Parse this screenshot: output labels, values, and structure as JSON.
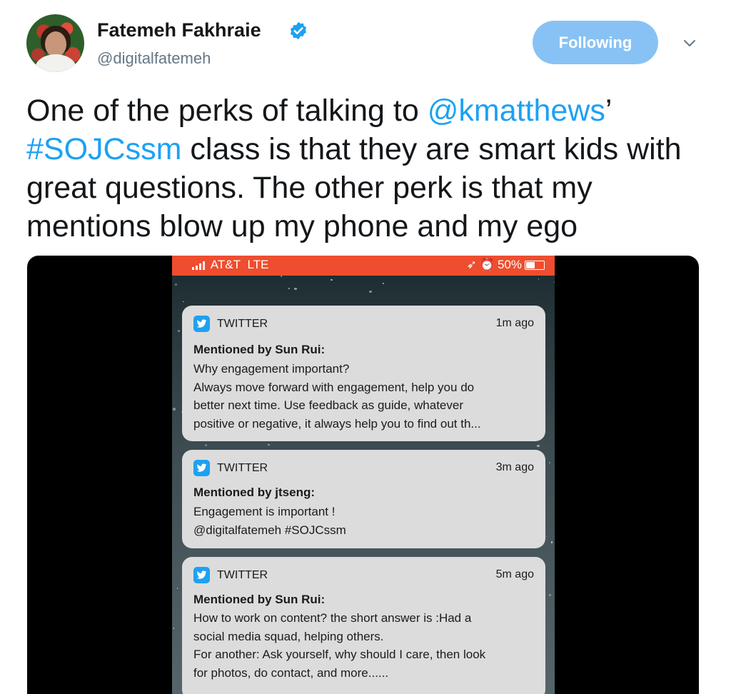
{
  "author": {
    "name": "Fatemeh Fakhraie",
    "handle": "@digitalfatemeh",
    "verified": true
  },
  "follow_button": {
    "label": "Following"
  },
  "menu_icon": "chevron-down-icon",
  "tweet": {
    "segments": [
      {
        "text": "One of the perks of talking to ",
        "type": "text"
      },
      {
        "text": "@kmatthews",
        "type": "mention"
      },
      {
        "text": "’ ",
        "type": "text"
      },
      {
        "text": "#SOJCssm",
        "type": "hashtag"
      },
      {
        "text": " class is that they are smart kids with great questions. The other perk is that my mentions blow up my phone and my ego",
        "type": "text"
      }
    ]
  },
  "phone": {
    "status": {
      "carrier": "AT&T",
      "network": "LTE",
      "battery": "50%"
    },
    "notifications": [
      {
        "app": "TWITTER",
        "time": "1m ago",
        "title": "Mentioned by Sun Rui:",
        "lines": [
          "Why engagement important?",
          "Always move forward with engagement, help you do",
          "better next time. Use feedback as guide, whatever",
          "positive or negative, it always help you to find out th..."
        ]
      },
      {
        "app": "TWITTER",
        "time": "3m ago",
        "title": "Mentioned by jtseng:",
        "lines": [
          "Engagement is important !",
          "@digitalfatemeh  #SOJCssm"
        ]
      },
      {
        "app": "TWITTER",
        "time": "5m ago",
        "title": "Mentioned by Sun Rui:",
        "lines": [
          "How to work on content? the short answer is :Had a",
          "social media squad, helping others.",
          "For another: Ask yourself, why should I care, then look",
          "for photos, do contact, and more......"
        ]
      }
    ]
  },
  "colors": {
    "link": "#1da1f2",
    "follow_button": "#88c2f4",
    "status_bar": "#ee4d2f"
  }
}
